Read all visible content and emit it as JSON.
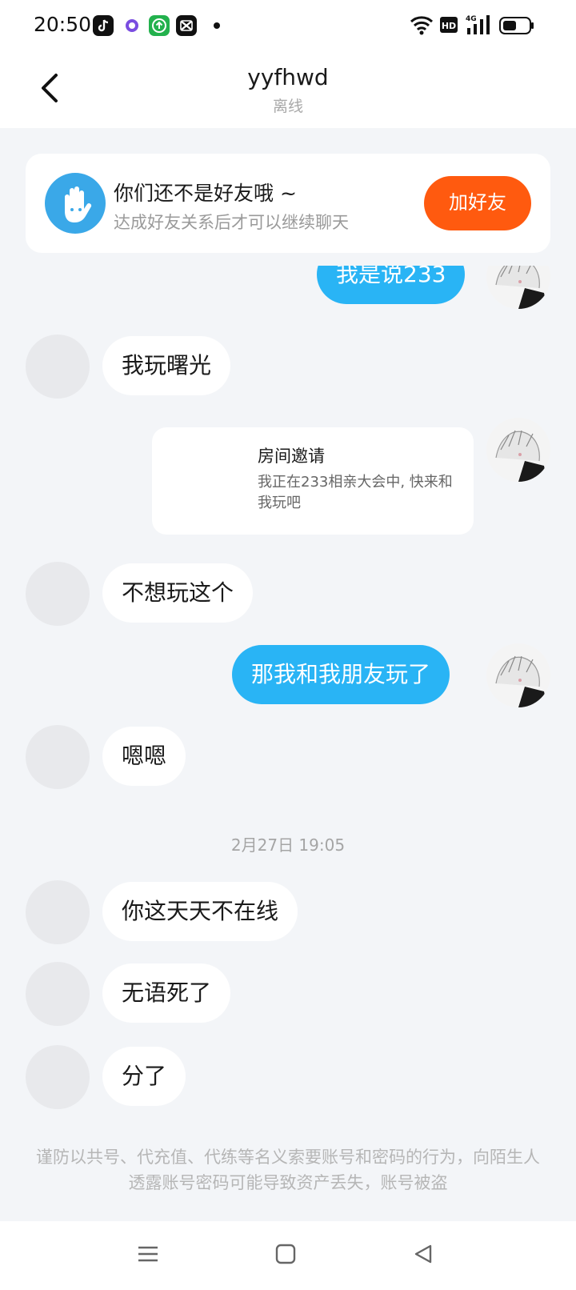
{
  "status_bar": {
    "time": "20:50",
    "icons": [
      "tiktok-app-icon",
      "app-circle-icon",
      "download-app-icon",
      "capcut-app-icon",
      "notification-dot-icon",
      "wifi-icon",
      "hd-icon",
      "4g-signal-icon",
      "battery-icon"
    ],
    "hd_label": "HD",
    "network_label": "4G"
  },
  "header": {
    "title": "yyfhwd",
    "subtitle": "离线"
  },
  "friend_banner": {
    "title": "你们还不是好友哦 ~",
    "description": "达成好友关系后才可以继续聊天",
    "button_label": "加好友",
    "accent_color": "#ff5a0f"
  },
  "messages": [
    {
      "side": "out",
      "text": "我是说233"
    },
    {
      "side": "in",
      "text": "我玩曙光"
    },
    {
      "side": "out",
      "type": "card",
      "title": "房间邀请",
      "description": "我正在233相亲大会中, 快来和我玩吧"
    },
    {
      "side": "in",
      "text": "不想玩这个"
    },
    {
      "side": "out",
      "text": "那我和我朋友玩了"
    },
    {
      "side": "in",
      "text": "嗯嗯"
    },
    {
      "type": "timestamp",
      "text": "2月27日 19:05"
    },
    {
      "side": "in",
      "text": "你这天天不在线"
    },
    {
      "side": "in",
      "text": "无语死了"
    },
    {
      "side": "in",
      "text": "分了"
    }
  ],
  "notice": "谨防以共号、代充值、代练等名义索要账号和密码的行为，向陌生人透露账号密码可能导致资产丢失，账号被盗",
  "colors": {
    "outgoing_bubble": "#29b4f5",
    "incoming_bubble": "#ffffff",
    "background": "#f3f5f8"
  },
  "nav_bar": {
    "icons": [
      "menu-icon",
      "home-square-icon",
      "back-triangle-icon"
    ]
  }
}
